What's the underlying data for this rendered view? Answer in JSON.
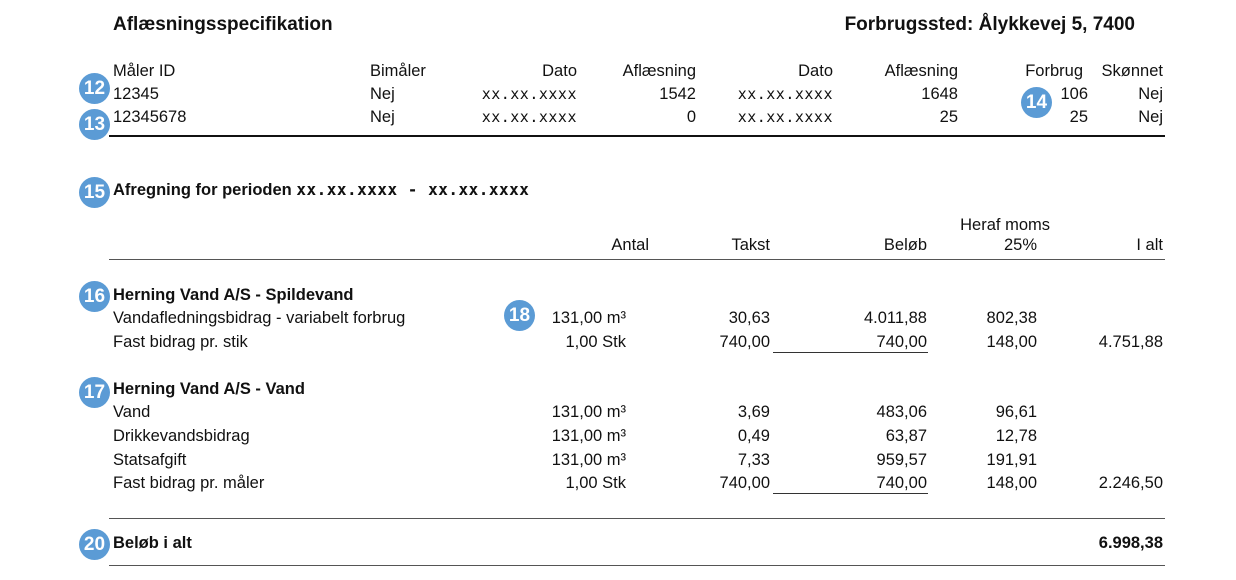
{
  "header": {
    "title": "Aflæsningsspecifikation",
    "location": "Forbrugssted: Ålykkevej 5, 7400"
  },
  "meter_table": {
    "columns": [
      "Måler ID",
      "Bimåler",
      "Dato",
      "Aflæsning",
      "Dato",
      "Aflæsning",
      "Forbrug",
      "Skønnet"
    ],
    "rows": [
      [
        "12345",
        "Nej",
        "xx.xx.xxxx",
        "1542",
        "xx.xx.xxxx",
        "1648",
        "106",
        "Nej"
      ],
      [
        "12345678",
        "Nej",
        "xx.xx.xxxx",
        "0",
        "xx.xx.xxxx",
        "25",
        "25",
        "Nej"
      ]
    ]
  },
  "period": {
    "label": "Afregning for perioden",
    "range": "xx.xx.xxxx - xx.xx.xxxx"
  },
  "billing_header": {
    "antal": "Antal",
    "takst": "Takst",
    "beloeb": "Beløb",
    "moms_line1": "Heraf moms",
    "moms_line2": "25%",
    "i_alt": "I alt"
  },
  "groups": [
    {
      "name": "Herning Vand A/S - Spildevand",
      "lines": [
        {
          "desc": "Vandafledningsbidrag - variabelt forbrug",
          "antal": "131,00 m³",
          "takst": "30,63",
          "beloeb": "4.011,88",
          "moms": "802,38",
          "i_alt": ""
        },
        {
          "desc": "Fast bidrag pr. stik",
          "antal": "1,00 Stk",
          "takst": "740,00",
          "beloeb": "740,00",
          "moms": "148,00",
          "i_alt": "4.751,88"
        }
      ]
    },
    {
      "name": "Herning Vand A/S - Vand",
      "lines": [
        {
          "desc": "Vand",
          "antal": "131,00 m³",
          "takst": "3,69",
          "beloeb": "483,06",
          "moms": "96,61",
          "i_alt": ""
        },
        {
          "desc": "Drikkevandsbidrag",
          "antal": "131,00 m³",
          "takst": "0,49",
          "beloeb": "63,87",
          "moms": "12,78",
          "i_alt": ""
        },
        {
          "desc": "Statsafgift",
          "antal": "131,00 m³",
          "takst": "7,33",
          "beloeb": "959,57",
          "moms": "191,91",
          "i_alt": ""
        },
        {
          "desc": "Fast bidrag pr. måler",
          "antal": "1,00 Stk",
          "takst": "740,00",
          "beloeb": "740,00",
          "moms": "148,00",
          "i_alt": "2.246,50"
        }
      ]
    }
  ],
  "total": {
    "label": "Beløb i alt",
    "value": "6.998,38"
  },
  "badges": [
    "12",
    "13",
    "14",
    "15",
    "16",
    "17",
    "18",
    "20"
  ],
  "colors": {
    "badge": "#5b9bd5"
  }
}
